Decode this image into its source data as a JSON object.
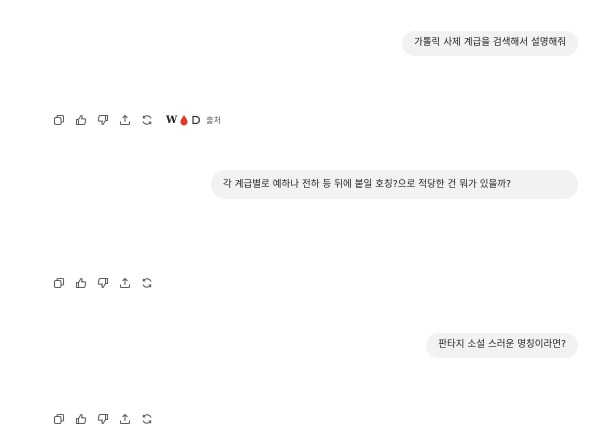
{
  "conversation": {
    "messages": [
      {
        "role": "user",
        "text": "가톨릭 사제 계급을 검색해서 설명해줘"
      },
      {
        "role": "user",
        "text": "각 계급별로 예하나 전하 등 뒤에 붙일 호칭?으로 적당한 건 뭐가 있을까?"
      },
      {
        "role": "user",
        "text": "판타지 소설 스러운 명칭이라면?"
      }
    ]
  },
  "response_actions": {
    "icons": [
      "copy-icon",
      "thumbs-up-icon",
      "thumbs-down-icon",
      "share-icon",
      "regenerate-icon"
    ],
    "sources": {
      "label": "출처",
      "icons": [
        "wikipedia-icon",
        "red-drop-icon",
        "outline-source-icon"
      ],
      "wiki_letter": "W"
    }
  },
  "colors": {
    "bubble_bg": "#f2f2f2",
    "icon_color": "#5f5f5f",
    "source_red": "#e03a2f"
  }
}
